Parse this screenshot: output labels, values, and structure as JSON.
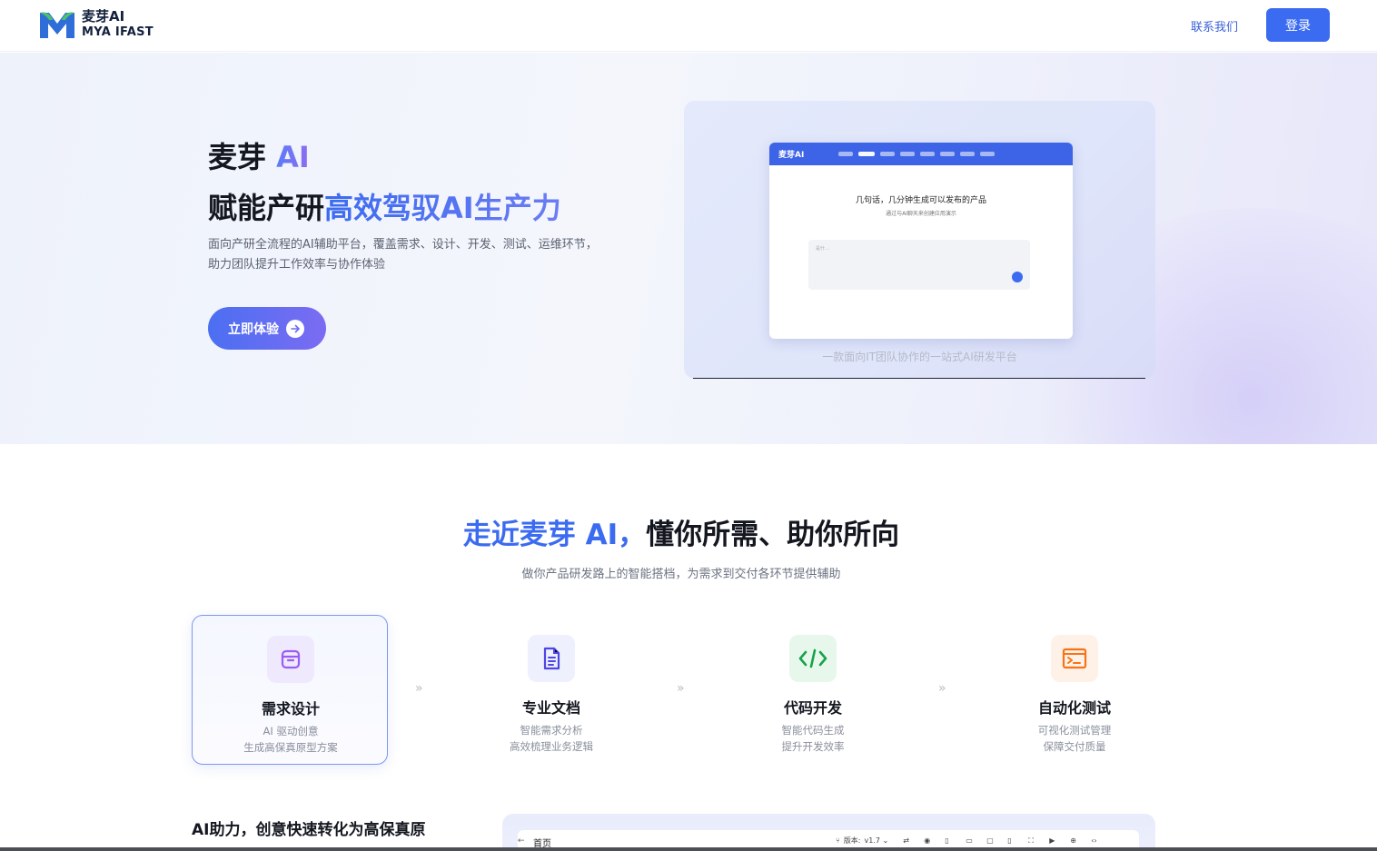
{
  "header": {
    "logo_line1": "麦芽AI",
    "logo_line2": "MYA IFAST",
    "contact": "联系我们",
    "login": "登录"
  },
  "hero": {
    "title1_prefix": "麦芽 ",
    "title1_ai": "AI",
    "title2_prefix": "赋能产研",
    "title2_highlight": "高效驾驭AI生产力",
    "desc_line1": "面向产研全流程的AI辅助平台，覆盖需求、设计、开发、测试、运维环节，",
    "desc_line2": "助力团队提升工作效率与协作体验",
    "cta": "立即体验"
  },
  "preview": {
    "mini_logo": "麦芽AI",
    "mini_heading": "几句话，几分钟生成可以发布的产品",
    "mini_sub": "通过与AI聊天来创建应用演示",
    "mini_placeholder": "是什…",
    "caption": "一款面向IT团队协作的一站式AI研发平台"
  },
  "section": {
    "title_highlight": "走近麦芽 AI，",
    "title_rest": "懂你所需、助你所向",
    "subtitle": "做你产品研发路上的智能搭档，为需求到交付各环节提供辅助"
  },
  "features": [
    {
      "title": "需求设计",
      "d1": "AI 驱动创意",
      "d2": "生成高保真原型方案",
      "icon": "box-icon",
      "color": "#8b5cf6"
    },
    {
      "title": "专业文档",
      "d1": "智能需求分析",
      "d2": "高效梳理业务逻辑",
      "icon": "document-icon",
      "color": "#4f46e5"
    },
    {
      "title": "代码开发",
      "d1": "智能代码生成",
      "d2": "提升开发效率",
      "icon": "code-icon",
      "color": "#16a34a"
    },
    {
      "title": "自动化测试",
      "d1": "可视化测试管理",
      "d2": "保障交付质量",
      "icon": "terminal-icon",
      "color": "#f97316"
    }
  ],
  "bottom": {
    "heading": "AI助力，创意快速转化为高保真原",
    "home": "首页",
    "back": "←",
    "version_label": "版本:",
    "version": "v1.7 ⌄"
  }
}
